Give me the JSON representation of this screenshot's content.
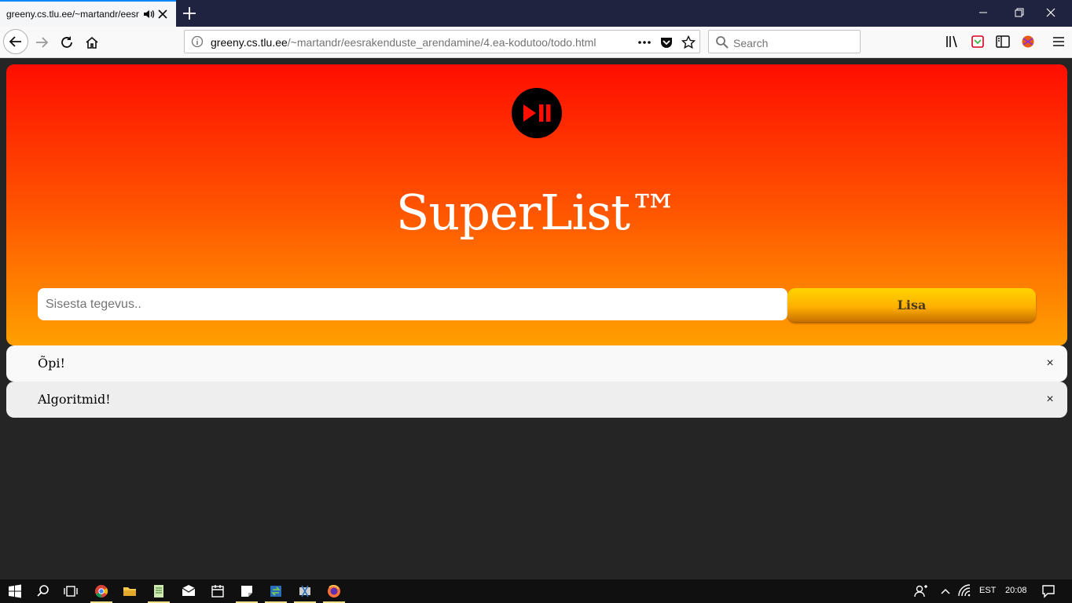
{
  "browser": {
    "tab_title": "greeny.cs.tlu.ee/~martandr/eesr",
    "url_host": "greeny.cs.tlu.ee",
    "url_path": "/~martandr/eesrakenduste_arendamine/4.ea-kodutoo/todo.html",
    "search_placeholder": "Search"
  },
  "app": {
    "title": "SuperList™",
    "input_placeholder": "Sisesta tegevus..",
    "add_label": "Lisa",
    "close_symbol": "×",
    "items": [
      {
        "text": "Õpi!"
      },
      {
        "text": "Algoritmid!"
      }
    ],
    "colors": {
      "gradient_top": "#ff0d00",
      "gradient_bottom": "#ffa000",
      "button": "#ffc400",
      "background": "#252525"
    }
  },
  "taskbar": {
    "language": "EST",
    "time": "20:08"
  }
}
